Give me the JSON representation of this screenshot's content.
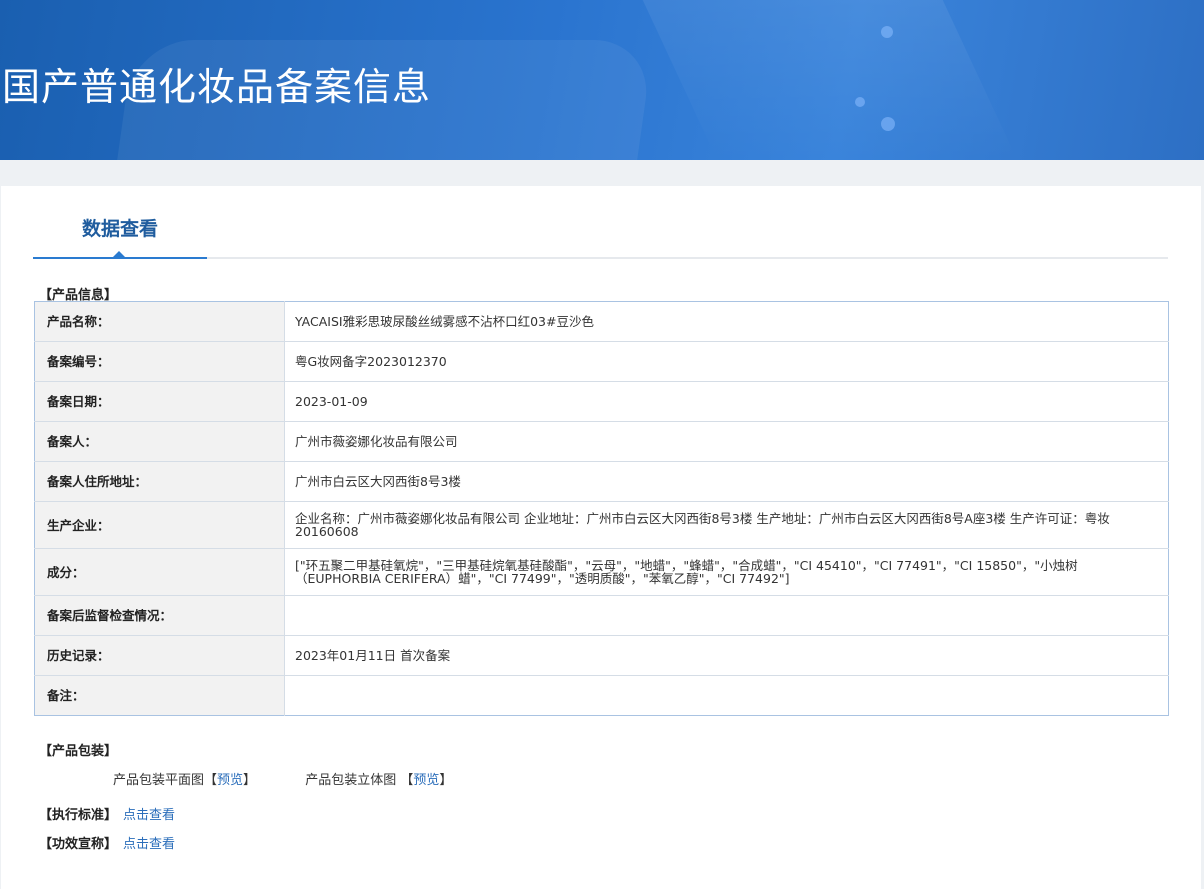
{
  "header": {
    "title": "国产普通化妆品备案信息"
  },
  "tabs": {
    "active_label": "数据查看"
  },
  "product_info": {
    "section_title": "【产品信息】",
    "rows": [
      {
        "label": "产品名称：",
        "value": "YACAISI雅彩思玻尿酸丝绒雾感不沾杯口红03#豆沙色"
      },
      {
        "label": "备案编号：",
        "value": "粤G妆网备字2023012370"
      },
      {
        "label": "备案日期：",
        "value": "2023-01-09"
      },
      {
        "label": "备案人：",
        "value": "广州市薇姿娜化妆品有限公司"
      },
      {
        "label": "备案人住所地址：",
        "value": "广州市白云区大冈西街8号3楼"
      },
      {
        "label": "生产企业：",
        "value": "企业名称：广州市薇姿娜化妆品有限公司 企业地址：广州市白云区大冈西街8号3楼 生产地址：广州市白云区大冈西街8号A座3楼 生产许可证：粤妆20160608"
      },
      {
        "label": "成分：",
        "value": "[\"环五聚二甲基硅氧烷\"，\"三甲基硅烷氧基硅酸酯\"，\"云母\"，\"地蜡\"，\"蜂蜡\"，\"合成蜡\"，\"CI 45410\"，\"CI 77491\"，\"CI 15850\"，\"小烛树（EUPHORBIA CERIFERA）蜡\"，\"CI 77499\"，\"透明质酸\"，\"苯氧乙醇\"，\"CI 77492\"]"
      },
      {
        "label": "备案后监督检查情况：",
        "value": ""
      },
      {
        "label": "历史记录：",
        "value": "2023年01月11日 首次备案"
      },
      {
        "label": "备注：",
        "value": ""
      }
    ]
  },
  "packaging": {
    "section_title": "【产品包装】",
    "flat_label": "产品包装平面图",
    "flat_link": "预览",
    "stereo_label": "产品包装立体图",
    "stereo_link": "预览",
    "bracket_open": "【",
    "bracket_close": "】",
    "bracket_open_spaced": " 【",
    "bracket_close_spaced": "】"
  },
  "standard": {
    "label": "【执行标准】",
    "link": "点击查看"
  },
  "efficacy": {
    "label": "【功效宣称】",
    "link": "点击查看"
  }
}
